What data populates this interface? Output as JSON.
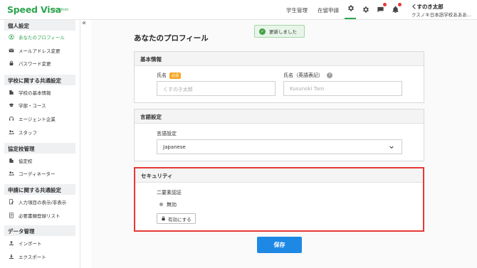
{
  "header": {
    "brand": "Speed Visa",
    "brand_sub": "for Admin",
    "nav": [
      "学生管理",
      "在留申請"
    ],
    "user_name": "くすのき太郎",
    "user_org": "クスノキ日本語学校あああ..."
  },
  "sidebar": {
    "sections": [
      {
        "title": "個人設定",
        "items": [
          "あなたのプロフィール",
          "メールアドレス変更",
          "パスワード変更"
        ]
      },
      {
        "title": "学校に関する共通設定",
        "items": [
          "学校の基本情報",
          "学部・コース",
          "エージェント企業",
          "スタッフ"
        ]
      },
      {
        "title": "協定校管理",
        "items": [
          "協定校",
          "コーディネーター"
        ]
      },
      {
        "title": "申請に関する共通設定",
        "items": [
          "入力項目の表示/非表示",
          "必要書類登録リスト"
        ]
      },
      {
        "title": "データ管理",
        "items": [
          "インポート",
          "エクスポート"
        ]
      }
    ],
    "active_item": "あなたのプロフィール"
  },
  "toast": {
    "message": "更新しました"
  },
  "page": {
    "title": "あなたのプロフィール"
  },
  "basic": {
    "title": "基本情報",
    "name_label": "氏名",
    "required_badge": "必須",
    "name_placeholder": "くすのき太郎",
    "name_en_label": "氏名（英語表記）",
    "name_en_placeholder": "Kusunoki Taro"
  },
  "language": {
    "title": "言語設定",
    "label": "言語設定",
    "selected": "Japanese"
  },
  "security": {
    "title": "セキュリティ",
    "label": "二要素認証",
    "status": "無効",
    "enable_button": "有効にする"
  },
  "save_button": "保存",
  "colors": {
    "brand": "#2ea44f",
    "primary": "#1e88e5",
    "highlight": "#e53935",
    "required": "#f5a623"
  }
}
